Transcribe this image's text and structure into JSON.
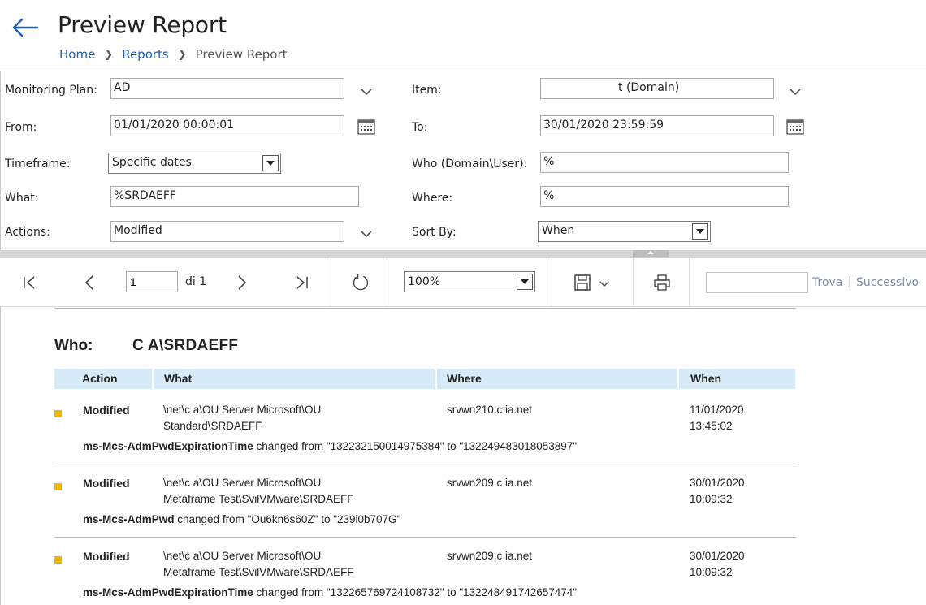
{
  "header": {
    "title": "Preview Report",
    "breadcrumb": [
      "Home",
      "Reports",
      "Preview Report"
    ]
  },
  "form": {
    "monitoring_plan_label": "Monitoring Plan:",
    "monitoring_plan_value": "AD",
    "item_label": "Item:",
    "item_value": "t (Domain)",
    "from_label": "From:",
    "from_value": "01/01/2020 00:00:01",
    "to_label": "To:",
    "to_value": "30/01/2020 23:59:59",
    "timeframe_label": "Timeframe:",
    "timeframe_value": "Specific dates",
    "who_label": "Who (Domain\\User):",
    "who_value": "%",
    "what_label": "What:",
    "what_value": "%SRDAEFF",
    "where_label": "Where:",
    "where_value": "%",
    "actions_label": "Actions:",
    "actions_value": "Modified",
    "sortby_label": "Sort By:",
    "sortby_value": "When"
  },
  "toolbar": {
    "page_value": "1",
    "of_label": "di 1",
    "zoom_value": "100%",
    "find_label": "Trova",
    "find_pipe": "|",
    "next_label": "Successivo"
  },
  "report": {
    "who_label": "Who:",
    "who_value": "C                         A\\SRDAEFF",
    "columns": [
      "Action",
      "What",
      "Where",
      "When"
    ],
    "rows": [
      {
        "action": "Modified",
        "what_line1": "\\net\\c              a\\OU Server Microsoft\\OU",
        "what_line2": "Standard\\SRDAEFF",
        "where": "srvwn210.c              ia.net",
        "when_date": "11/01/2020",
        "when_time": "13:45:02",
        "attr": "ms-Mcs-AdmPwdExpirationTime",
        "change": " changed from \"132232150014975384\" to \"132249483018053897\""
      },
      {
        "action": "Modified",
        "what_line1": "\\net\\c              a\\OU Server Microsoft\\OU",
        "what_line2": "Metaframe Test\\SvilVMware\\SRDAEFF",
        "where": "srvwn209.c              ia.net",
        "when_date": "30/01/2020",
        "when_time": "10:09:32",
        "attr": "ms-Mcs-AdmPwd",
        "change": " changed from \"Ou6kn6s60Z\" to \"239i0b707G\""
      },
      {
        "action": "Modified",
        "what_line1": "\\net\\c              a\\OU Server Microsoft\\OU",
        "what_line2": "Metaframe Test\\SvilVMware\\SRDAEFF",
        "where": "srvwn209.c              ia.net",
        "when_date": "30/01/2020",
        "when_time": "10:09:32",
        "attr": "ms-Mcs-AdmPwdExpirationTime",
        "change": " changed from \"132265769724108732\" to \"132248491742657474\""
      }
    ]
  },
  "colors": {
    "accent": "#1f5fb3",
    "header_row": "#d6eaf8",
    "bullet": "#f2b600"
  }
}
